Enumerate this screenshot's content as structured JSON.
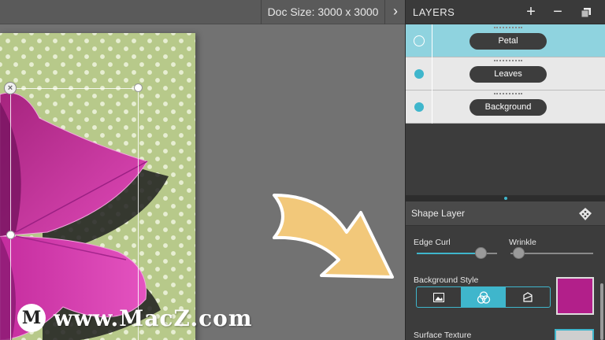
{
  "canvas": {
    "doc_size_label": "Doc Size: 3000 x 3000",
    "expand_glyph": "›",
    "close_glyph": "×"
  },
  "watermark": {
    "logo_letter": "M",
    "text": "www.MacZ.com"
  },
  "layers": {
    "title": "LAYERS",
    "add_glyph": "+",
    "remove_glyph": "−",
    "items": [
      {
        "name": "Petal",
        "active": true
      },
      {
        "name": "Leaves",
        "active": false
      },
      {
        "name": "Background",
        "active": false
      }
    ]
  },
  "shape_layer": {
    "title": "Shape Layer",
    "edge_curl_label": "Edge Curl",
    "edge_curl_value": 0.8,
    "wrinkle_label": "Wrinkle",
    "wrinkle_value": 0.1,
    "background_style_label": "Background Style",
    "background_style_options": [
      "image",
      "color-blend",
      "fill"
    ],
    "background_style_selected": 1,
    "background_color": "#b21f8a",
    "surface_texture_label": "Surface Texture"
  },
  "colors": {
    "accent": "#3fb6cc",
    "petal": "#d93bb2",
    "doc_bg": "#b7c98a",
    "arrow": "#f2c87a"
  }
}
